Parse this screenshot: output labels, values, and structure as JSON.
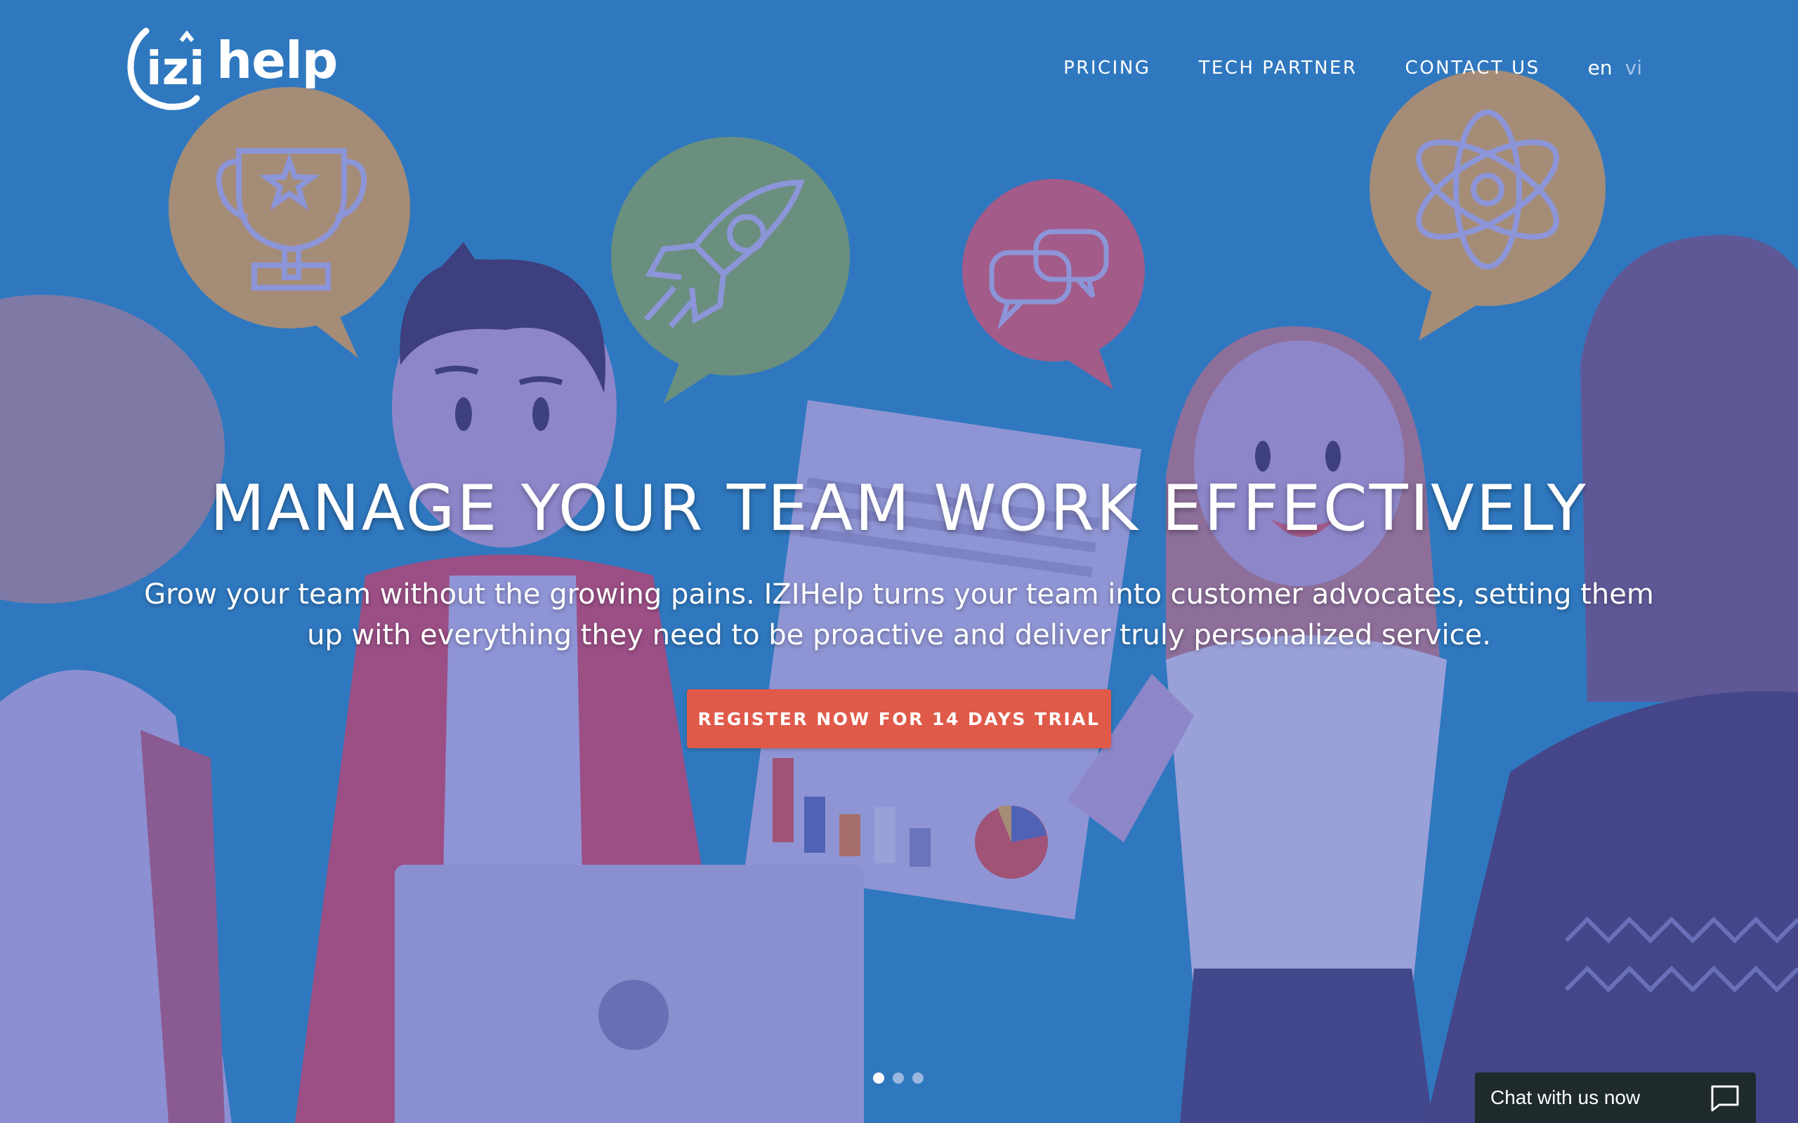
{
  "brand": {
    "logo_text": "help"
  },
  "nav": {
    "pricing": "PRICING",
    "tech_partner": "TECH PARTNER",
    "contact_us": "CONTACT US",
    "lang_en": "en",
    "lang_vi": "vi"
  },
  "hero": {
    "headline": "MANAGE YOUR TEAM WORK EFFECTIVELY",
    "subtext": "Grow your team without the growing pains. IZIHelp turns your team into customer advocates, setting them up with everything they need to be proactive and deliver truly personalized service.",
    "cta_label": "REGISTER NOW FOR 14 DAYS TRIAL",
    "slides": 3,
    "active_slide": 1
  },
  "chat": {
    "label": "Chat with us now"
  },
  "colors": {
    "background": "#2f78bf",
    "cta": "#e05a4a",
    "chat_bar": "#1e2a2c"
  }
}
